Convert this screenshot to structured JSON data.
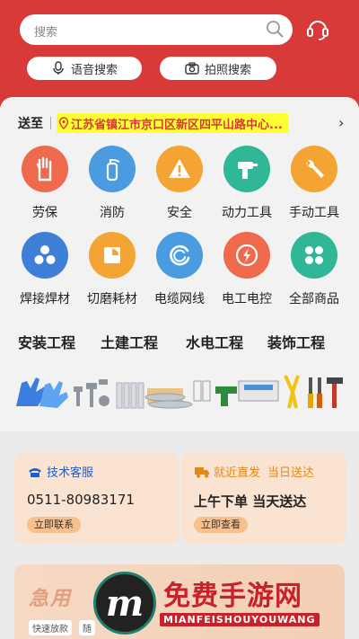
{
  "header": {
    "search_placeholder": "搜索",
    "voice_search_label": "语音搜索",
    "photo_search_label": "拍照搜索"
  },
  "delivery": {
    "label": "送至",
    "address": "江苏省镇江市京口区新区四平山路中心..."
  },
  "categories": [
    {
      "label": "劳保",
      "icon": "glove-icon",
      "color": "#ef6a4d"
    },
    {
      "label": "消防",
      "icon": "fire-extinguisher-icon",
      "color": "#4a9be0"
    },
    {
      "label": "安全",
      "icon": "warning-icon",
      "color": "#f3a433"
    },
    {
      "label": "动力工具",
      "icon": "drill-icon",
      "color": "#2fb797"
    },
    {
      "label": "手动工具",
      "icon": "wrench-icon",
      "color": "#f3a433"
    },
    {
      "label": "焊接焊材",
      "icon": "welding-icon",
      "color": "#3f7fd8"
    },
    {
      "label": "切磨耗材",
      "icon": "abrasive-icon",
      "color": "#f3a433"
    },
    {
      "label": "电缆网线",
      "icon": "cable-icon",
      "color": "#4a9be0"
    },
    {
      "label": "电工电控",
      "icon": "lightning-icon",
      "color": "#ef6a4d"
    },
    {
      "label": "全部商品",
      "icon": "grid-icon",
      "color": "#2fb797"
    }
  ],
  "engineering": [
    "安装工程",
    "土建工程",
    "水电工程",
    "装饰工程"
  ],
  "service_card": {
    "title": "技术客服",
    "phone": "0511-80983171",
    "button": "立即联系",
    "title_color": "#1d5ec9"
  },
  "shipping_card": {
    "title_a": "就近直发",
    "title_b": "当日送达",
    "main": "上午下单 当天送达",
    "button": "立即查看",
    "title_color": "#e08a16"
  },
  "banner": {
    "title": "急用",
    "tags": [
      "快速放款",
      "随"
    ]
  },
  "watermark": {
    "logo_letter": "m",
    "text": "免费手游网",
    "sub": "MIANFEISHOUYOUWANG"
  }
}
